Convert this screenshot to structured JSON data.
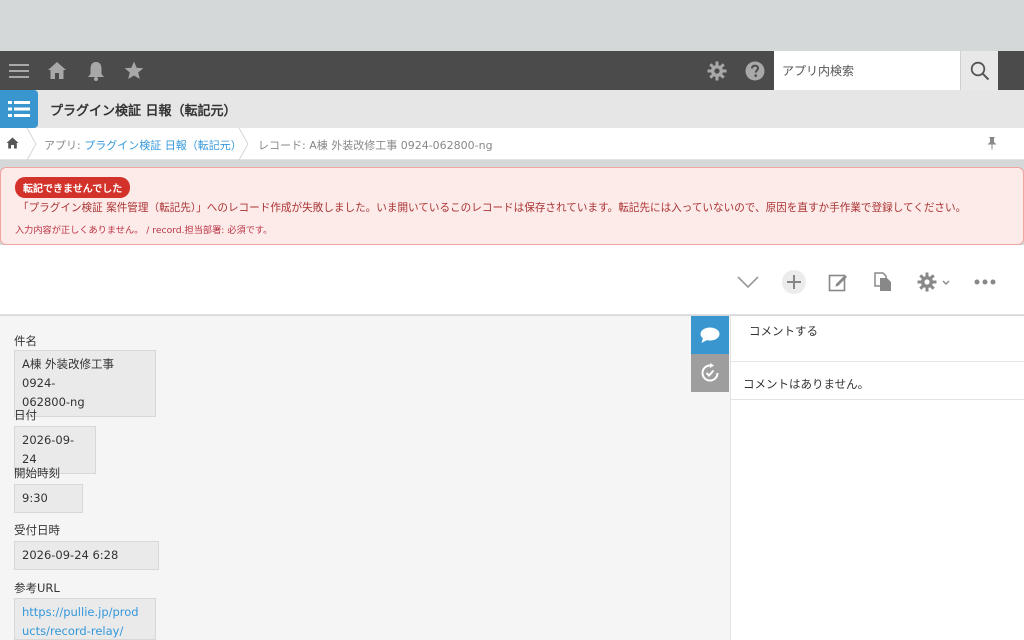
{
  "header": {
    "search_placeholder": "アプリ内検索",
    "icons": [
      "menu-icon",
      "home-icon",
      "bell-icon",
      "star-icon",
      "gear-icon",
      "help-icon",
      "search-icon"
    ]
  },
  "app": {
    "title": "プラグイン検証 日報（転記元）",
    "accent": "#3a96cf"
  },
  "breadcrumb": {
    "app_prefix": "アプリ: ",
    "app_name": "プラグイン検証 日報（転記元）",
    "record": "レコード: A棟 外装改修工事 0924-062800-ng"
  },
  "alert": {
    "badge": "転記できませんでした",
    "message": "「プラグイン検証 案件管理（転記先）」へのレコード作成が失敗しました。いま開いているこのレコードは保存されています。転記先には入っていないので、原因を直すか手作業で登録してください。",
    "detail": "入力内容が正しくありません。 / record.担当部署: 必須です。",
    "color": "#d3322b"
  },
  "fields": [
    {
      "label": "件名",
      "value_lines": [
        "A棟 外装改修工事 0924-",
        "062800-ng"
      ]
    },
    {
      "label": "日付",
      "value": "2026-09-24"
    },
    {
      "label": "開始時刻",
      "value": "9:30"
    },
    {
      "label": "受付日時",
      "value": "2026-09-24 6:28"
    },
    {
      "label": "参考URL",
      "value_lines": [
        "https://pullie.jp/prod",
        "ucts/record-relay/"
      ]
    }
  ],
  "comments": {
    "placeholder": "コメントする",
    "empty": "コメントはありません。"
  }
}
